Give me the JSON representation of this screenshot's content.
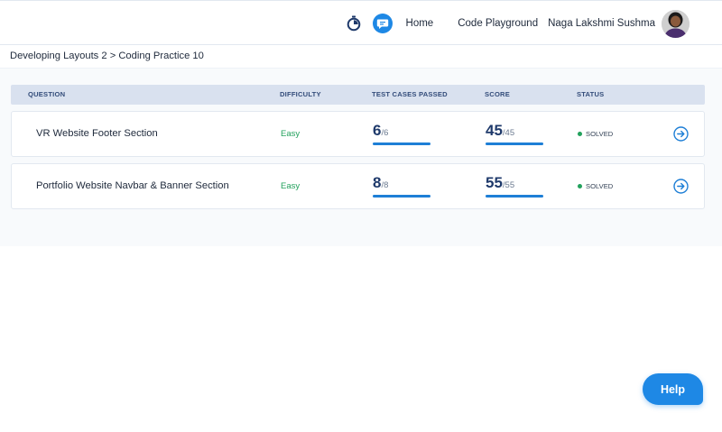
{
  "header": {
    "home_label": "Home",
    "playground_label": "Code Playground",
    "user_name": "Naga Lakshmi Sushma",
    "timer_icon": "stopwatch-icon",
    "chat_icon": "chat-bubble-icon",
    "avatar_icon": "user-avatar"
  },
  "breadcrumb": {
    "text": "Developing Layouts 2 > Coding Practice 10"
  },
  "table": {
    "headers": {
      "question": "QUESTION",
      "difficulty": "DIFFICULTY",
      "test_cases": "TEST CASES PASSED",
      "score": "SCORE",
      "status": "STATUS"
    },
    "rows": [
      {
        "question": "VR Website Footer Section",
        "difficulty": "Easy",
        "tests_passed": "6",
        "tests_total": "/6",
        "tests_fraction": 1.0,
        "score": "45",
        "score_total": "/45",
        "score_fraction": 1.0,
        "status": "SOLVED",
        "action_icon": "arrow-right-circle-icon"
      },
      {
        "question": "Portfolio Website Navbar & Banner Section",
        "difficulty": "Easy",
        "tests_passed": "8",
        "tests_total": "/8",
        "tests_fraction": 1.0,
        "score": "55",
        "score_total": "/55",
        "score_fraction": 1.0,
        "status": "SOLVED",
        "action_icon": "arrow-right-circle-icon"
      }
    ]
  },
  "help": {
    "label": "Help"
  },
  "colors": {
    "accent": "#1e88e5",
    "easy_green": "#22a15c",
    "header_bg": "#d9e1ef",
    "progress_bar": "#1e7fd6"
  }
}
